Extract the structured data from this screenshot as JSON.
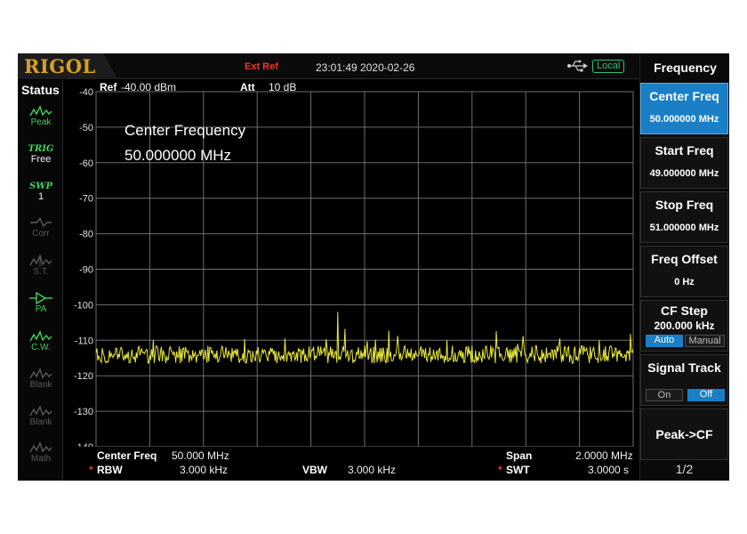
{
  "header": {
    "brand": "RIGOL",
    "ext_ref": "Ext Ref",
    "datetime": "23:01:49 2020-02-26",
    "usb_icon": "usb-icon",
    "local": "Local"
  },
  "status": {
    "title": "Status",
    "items": [
      {
        "label": "Peak",
        "icon": "peak-icon",
        "state": "active"
      },
      {
        "label": "TRIG",
        "sub": "Free",
        "state": "active"
      },
      {
        "label": "SWP",
        "sub": "1",
        "state": "active"
      },
      {
        "label": "Corr",
        "icon": "corr-icon",
        "state": "dim"
      },
      {
        "label": "S.T.",
        "icon": "st-icon",
        "state": "dim"
      },
      {
        "label": "PA",
        "icon": "amplifier-icon",
        "state": "active"
      },
      {
        "label": "C.W.",
        "icon": "cw-icon",
        "state": "active"
      },
      {
        "label": "Blank",
        "icon": "blank-icon",
        "state": "dim"
      },
      {
        "label": "Blank",
        "icon": "blank-icon",
        "state": "dim"
      },
      {
        "label": "Math",
        "icon": "math-icon",
        "state": "dim"
      }
    ]
  },
  "plot": {
    "ref_label": "Ref",
    "ref_value": "-40.00 dBm",
    "att_label": "Att",
    "att_value": "10 dB",
    "marker_title": "Center Frequency",
    "marker_value": "50.000000 MHz"
  },
  "footer": {
    "center_label": "Center Freq",
    "center_value": "50.000 MHz",
    "span_label": "Span",
    "span_value": "2.0000 MHz",
    "rbw_label": "RBW",
    "rbw_value": "3.000 kHz",
    "vbw_label": "VBW",
    "vbw_value": "3.000 kHz",
    "swt_label": "SWT",
    "swt_value": "3.0000 s",
    "star": "*"
  },
  "menu": {
    "title": "Frequency",
    "center_freq": {
      "title": "Center Freq",
      "value": "50.000000 MHz"
    },
    "start_freq": {
      "title": "Start Freq",
      "value": "49.000000 MHz"
    },
    "stop_freq": {
      "title": "Stop Freq",
      "value": "51.000000 MHz"
    },
    "freq_offset": {
      "title": "Freq Offset",
      "value": "0 Hz"
    },
    "cf_step": {
      "title": "CF Step",
      "value": "200.000 kHz",
      "auto": "Auto",
      "manual": "Manual"
    },
    "signal_track": {
      "title": "Signal Track",
      "on": "On",
      "off": "Off"
    },
    "peak_cf": {
      "title": "Peak->CF"
    },
    "page": "1/2"
  },
  "colors": {
    "trace": "#e8e83a",
    "grid": "#6e6e6e",
    "accent": "#1b7fc6",
    "status_green": "#3fd25a",
    "brand_gold": "#d8a11e",
    "alert_red": "#e83a2c"
  },
  "chart_data": {
    "type": "line",
    "x_range": [
      49.0,
      51.0
    ],
    "x_unit": "MHz",
    "ylim": [
      -140,
      -40
    ],
    "y_ticks": [
      -40,
      -50,
      -60,
      -70,
      -80,
      -90,
      -100,
      -110,
      -120,
      -130,
      -140
    ],
    "grid": true,
    "series": [
      {
        "noise_floor_dbm": -114,
        "peak_max_dbm": -102,
        "peak_x_mhz": 49.9
      }
    ]
  }
}
